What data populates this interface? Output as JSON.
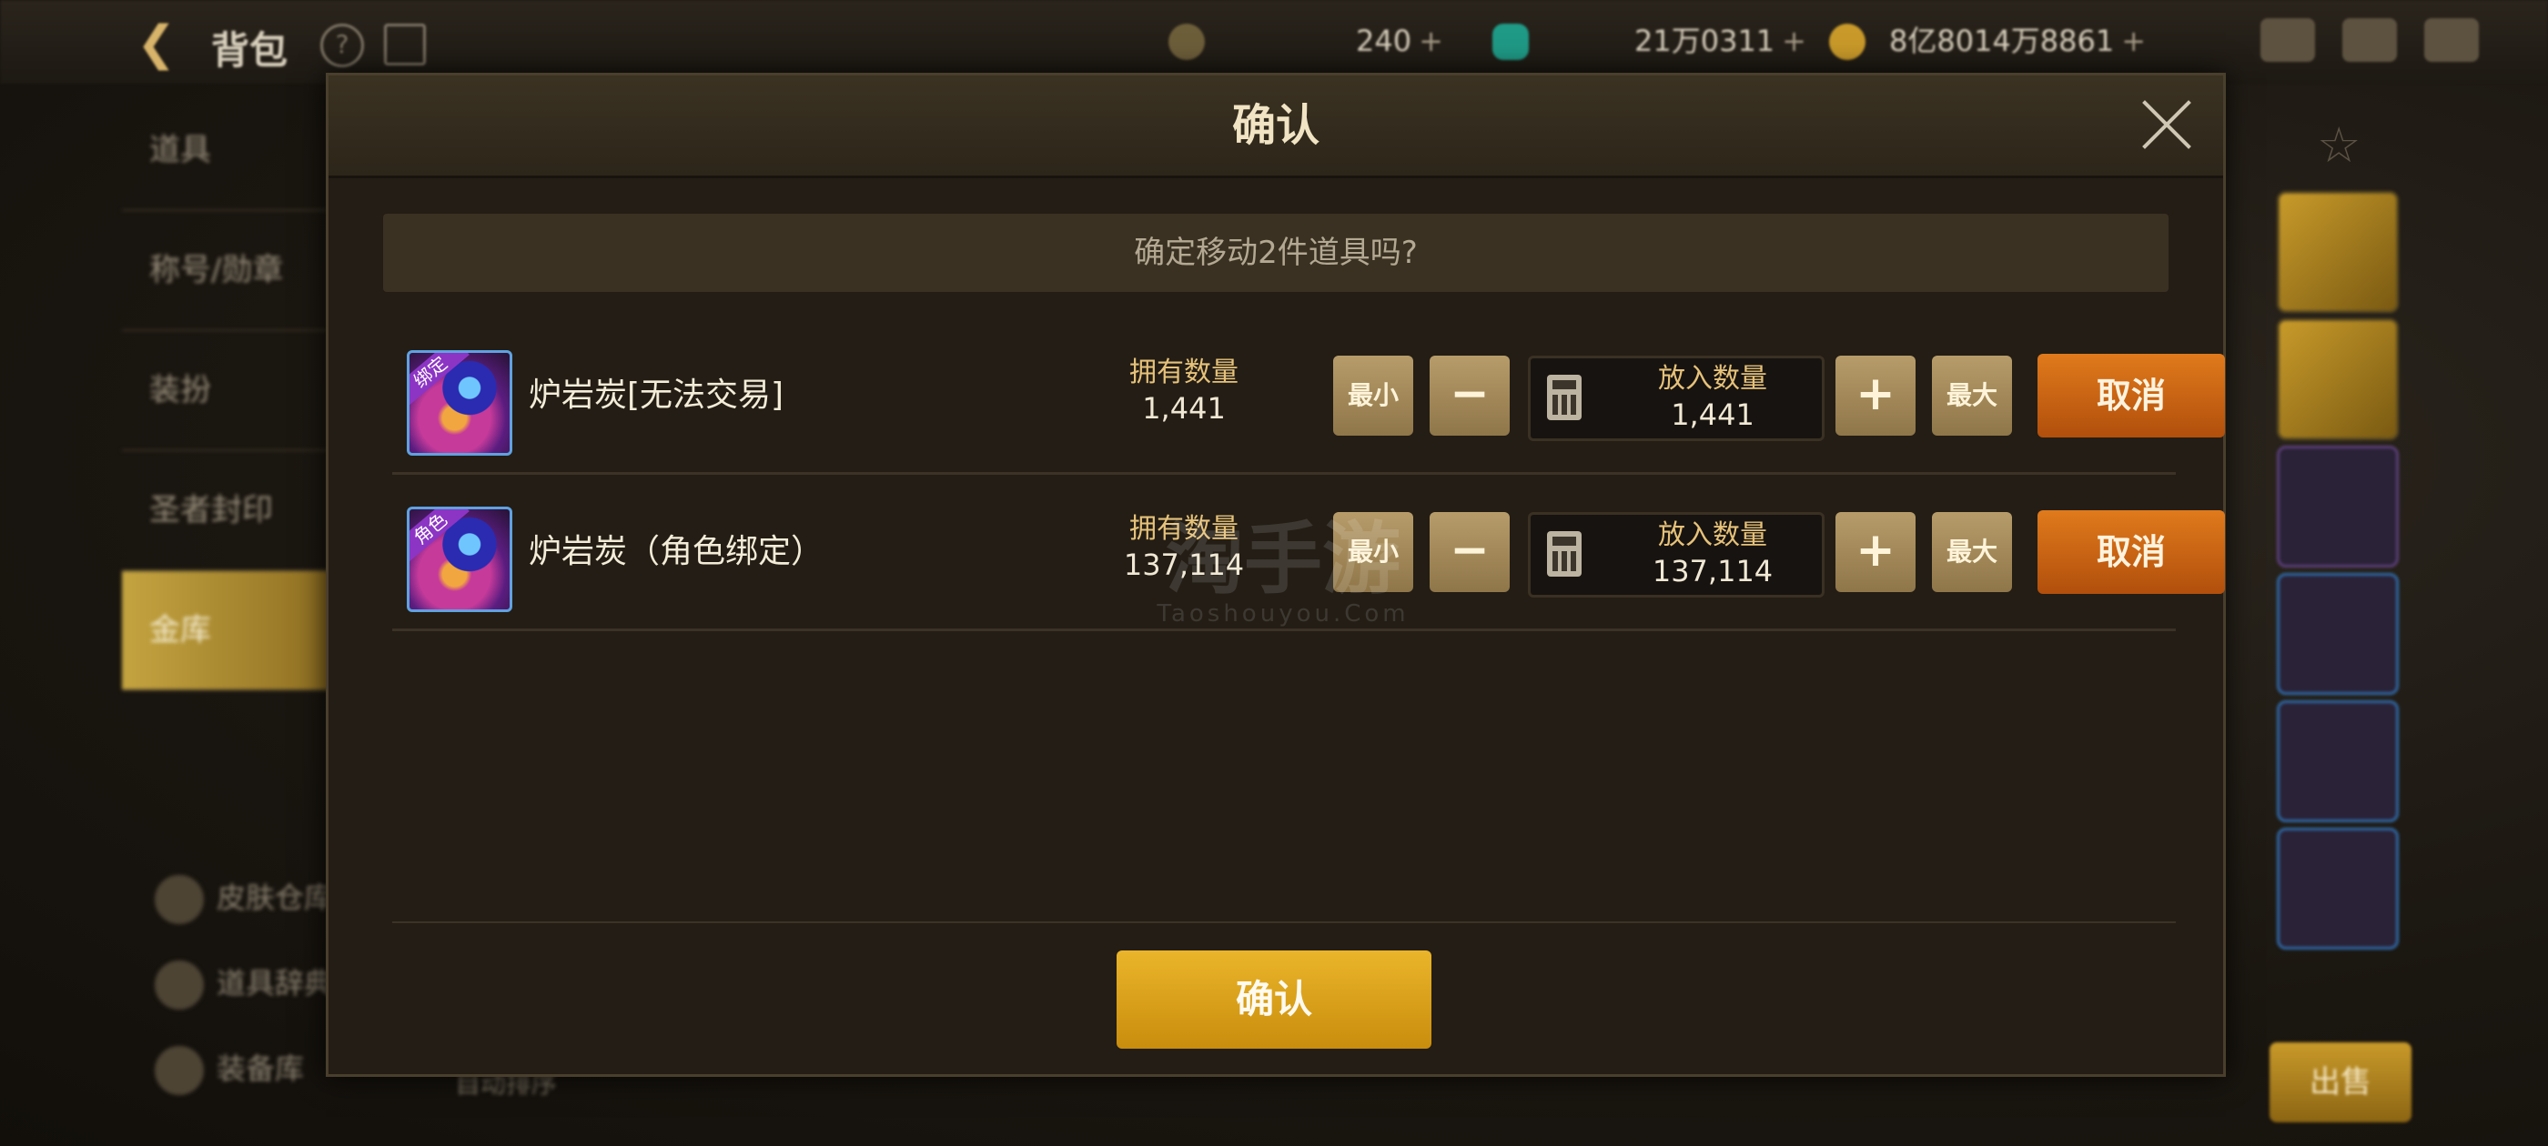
{
  "background": {
    "header": {
      "back_icon": "arrow-left-icon",
      "title": "背包",
      "currencies": [
        {
          "icon": "coin-c-icon",
          "value": "240"
        },
        {
          "icon": "gem-icon",
          "value": "21万0311"
        },
        {
          "icon": "gold-coin-icon",
          "value": "8亿8014万8861"
        }
      ]
    },
    "sidebar": {
      "items": [
        {
          "label": "道具"
        },
        {
          "label": "称号/勋章"
        },
        {
          "label": "装扮"
        },
        {
          "label": "圣者封印"
        },
        {
          "label": "金库",
          "active": true
        }
      ],
      "bottom_items": [
        {
          "label": "皮肤仓库"
        },
        {
          "label": "道具辞典"
        },
        {
          "label": "装备库"
        }
      ],
      "sort_label": "自动排序"
    },
    "sell_label": "出售"
  },
  "dialog": {
    "title": "确认",
    "message": "确定移动2件道具吗?",
    "items": [
      {
        "name": "炉岩炭[无法交易]",
        "tag": "绑定",
        "own_label": "拥有数量",
        "own_value": "1,441",
        "min_label": "最小",
        "max_label": "最大",
        "put_label": "放入数量",
        "put_value": "1,441",
        "cancel_label": "取消"
      },
      {
        "name": "炉岩炭（角色绑定）",
        "tag": "角色",
        "own_label": "拥有数量",
        "own_value": "137,114",
        "min_label": "最小",
        "max_label": "最大",
        "put_label": "放入数量",
        "put_value": "137,114",
        "cancel_label": "取消"
      }
    ],
    "confirm_label": "确认"
  },
  "watermark": {
    "big": "淘手游",
    "small": "Taoshouyou.Com"
  },
  "colors": {
    "accent_gold": "#c98d0d",
    "cancel_orange": "#d06a16",
    "dialog_bg": "#231d15"
  }
}
